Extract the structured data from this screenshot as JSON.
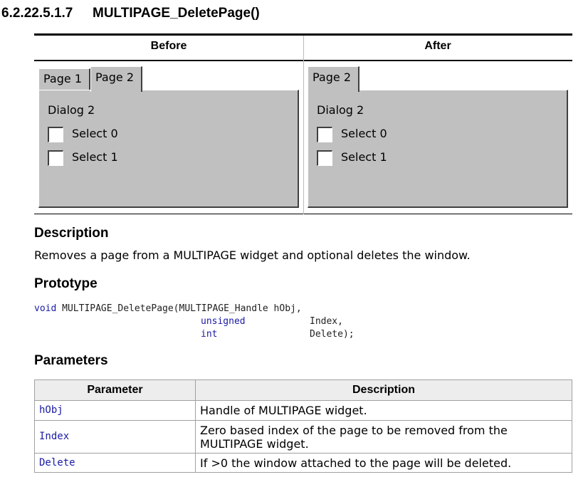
{
  "heading": {
    "number": "6.2.22.5.1.7",
    "title": "MULTIPAGE_DeletePage()"
  },
  "before_after": {
    "before_label": "Before",
    "after_label": "After",
    "before": {
      "tabs": [
        "Page 1",
        "Page 2"
      ],
      "dialog_label": "Dialog 2",
      "checkboxes": [
        "Select 0",
        "Select 1"
      ]
    },
    "after": {
      "tabs": [
        "Page 2"
      ],
      "dialog_label": "Dialog 2",
      "checkboxes": [
        "Select 0",
        "Select 1"
      ]
    }
  },
  "description": {
    "heading": "Description",
    "text": "Removes a page from a MULTIPAGE widget and optional deletes the window."
  },
  "prototype": {
    "heading": "Prototype",
    "line1_type": "void",
    "line1_func": " MULTIPAGE_DeletePage(MULTIPAGE_Handle hObj,",
    "line2_type": "unsigned",
    "line2_arg": "Index,",
    "line3_type": "int",
    "line3_arg": "Delete);"
  },
  "parameters": {
    "heading": "Parameters",
    "col_param": "Parameter",
    "col_desc": "Description",
    "rows": [
      {
        "name": "hObj",
        "desc": "Handle of MULTIPAGE widget."
      },
      {
        "name": "Index",
        "desc": "Zero based index of the page to be removed from the MULTIPAGE widget."
      },
      {
        "name": "Delete",
        "desc": "If >0 the window attached to the page will be deleted."
      }
    ]
  }
}
